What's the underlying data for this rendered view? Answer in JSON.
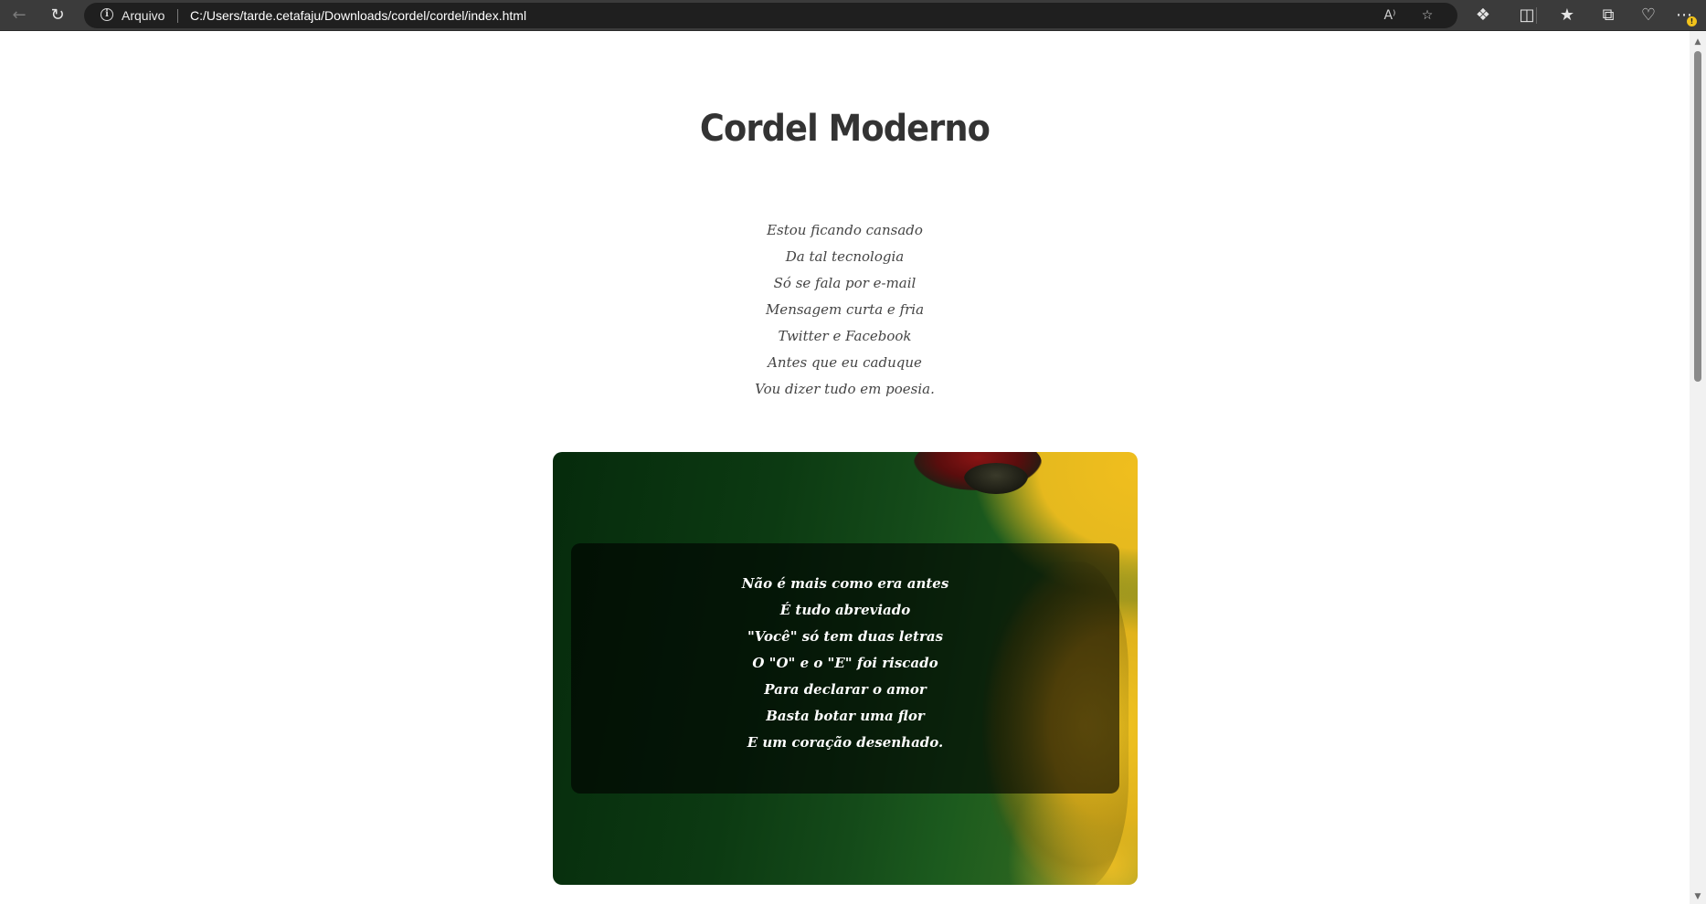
{
  "browser": {
    "address_label": "Arquivo",
    "url": "C:/Users/tarde.cetafaju/Downloads/cordel/cordel/index.html",
    "info_glyph": "i",
    "read_aloud_glyph": "A⁾",
    "icons": [
      "back-icon",
      "refresh-icon",
      "site-info-icon",
      "read-aloud-icon",
      "favorite-star-icon",
      "extensions-icon",
      "split-screen-icon",
      "favorites-icon",
      "collections-icon",
      "browser-essentials-icon",
      "more-icon"
    ],
    "notification_badge": "!"
  },
  "page": {
    "title": "Cordel Moderno",
    "stanza1": [
      "Estou ficando cansado",
      "Da tal tecnologia",
      "Só se fala por e-mail",
      "Mensagem curta e fria",
      "Twitter e Facebook",
      "Antes que eu caduque",
      "Vou dizer tudo em poesia."
    ],
    "stanza2": [
      "Não é mais como era antes",
      "É tudo abreviado",
      "\"Você\" só tem duas letras",
      "O \"O\" e o \"E\" foi riscado",
      "Para declarar o amor",
      "Basta botar uma flor",
      "E um coração desenhado."
    ]
  },
  "colors": {
    "chrome": "#3b3b3b",
    "address_bg": "#1f1f1f",
    "title": "#333333",
    "poem_text": "#444444",
    "overlay_text": "#ffffff"
  }
}
